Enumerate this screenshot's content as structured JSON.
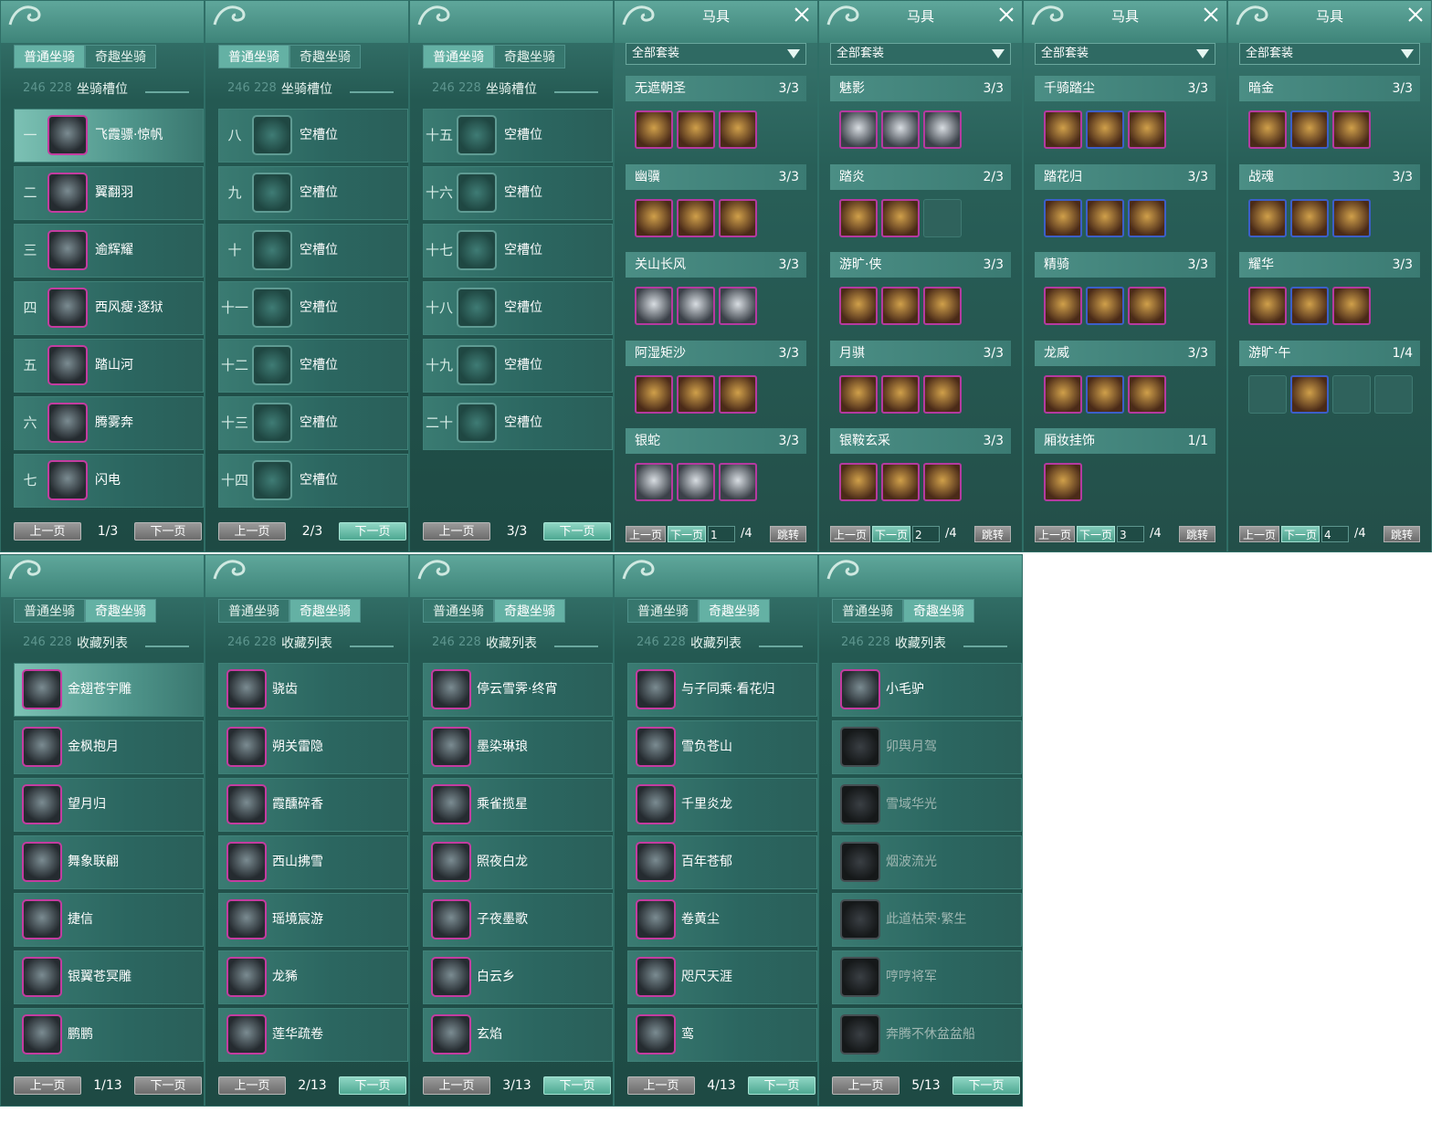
{
  "tabs": {
    "normal": "普通坐骑",
    "fun": "奇趣坐骑"
  },
  "ghost_numbers": "246  228",
  "slot_title": "坐骑槽位",
  "collection_title": "收藏列表",
  "prev_label": "上一页",
  "next_label": "下一页",
  "mount_pages": [
    {
      "page": "1/3",
      "rows": [
        {
          "num": "一",
          "name": "飞霞骠·惊帆",
          "state": "mount"
        },
        {
          "num": "二",
          "name": "翼翻羽",
          "state": "mount"
        },
        {
          "num": "三",
          "name": "逾辉耀",
          "state": "mount"
        },
        {
          "num": "四",
          "name": "西风瘦·逐狱",
          "state": "mount"
        },
        {
          "num": "五",
          "name": "踏山河",
          "state": "mount"
        },
        {
          "num": "六",
          "name": "腾雾奔",
          "state": "mount"
        },
        {
          "num": "七",
          "name": "闪电",
          "state": "mount"
        }
      ]
    },
    {
      "page": "2/3",
      "rows": [
        {
          "num": "八",
          "name": "空槽位",
          "state": "empty"
        },
        {
          "num": "九",
          "name": "空槽位",
          "state": "empty"
        },
        {
          "num": "十",
          "name": "空槽位",
          "state": "empty"
        },
        {
          "num": "十一",
          "name": "空槽位",
          "state": "empty"
        },
        {
          "num": "十二",
          "name": "空槽位",
          "state": "empty"
        },
        {
          "num": "十三",
          "name": "空槽位",
          "state": "empty"
        },
        {
          "num": "十四",
          "name": "空槽位",
          "state": "empty"
        }
      ]
    },
    {
      "page": "3/3",
      "rows": [
        {
          "num": "十五",
          "name": "空槽位",
          "state": "empty"
        },
        {
          "num": "十六",
          "name": "空槽位",
          "state": "empty"
        },
        {
          "num": "十七",
          "name": "空槽位",
          "state": "empty"
        },
        {
          "num": "十八",
          "name": "空槽位",
          "state": "empty"
        },
        {
          "num": "十九",
          "name": "空槽位",
          "state": "empty"
        },
        {
          "num": "二十",
          "name": "空槽位",
          "state": "empty"
        }
      ]
    }
  ],
  "harness": {
    "title": "马具",
    "filter": "全部套装",
    "jump_label": "跳转",
    "total": "/4",
    "pages": [
      {
        "page_input": "1",
        "sets": [
          {
            "name": "无遮朝圣",
            "count": "3/3",
            "items": 3,
            "owned": 3
          },
          {
            "name": "幽骥",
            "count": "3/3",
            "items": 3,
            "owned": 3
          },
          {
            "name": "关山长风",
            "count": "3/3",
            "items": 3,
            "owned": 3
          },
          {
            "name": "阿湿矩沙",
            "count": "3/3",
            "items": 3,
            "owned": 3
          },
          {
            "name": "银蛇",
            "count": "3/3",
            "items": 3,
            "owned": 3
          }
        ]
      },
      {
        "page_input": "2",
        "sets": [
          {
            "name": "魅影",
            "count": "3/3",
            "items": 3,
            "owned": 3
          },
          {
            "name": "踏炎",
            "count": "2/3",
            "items": 3,
            "owned": 2
          },
          {
            "name": "游旷·侠",
            "count": "3/3",
            "items": 3,
            "owned": 3
          },
          {
            "name": "月骐",
            "count": "3/3",
            "items": 3,
            "owned": 3
          },
          {
            "name": "银鞍玄采",
            "count": "3/3",
            "items": 3,
            "owned": 3
          }
        ]
      },
      {
        "page_input": "3",
        "sets": [
          {
            "name": "千骑踏尘",
            "count": "3/3",
            "items": 3,
            "owned": 3
          },
          {
            "name": "踏花归",
            "count": "3/3",
            "items": 3,
            "owned": 3
          },
          {
            "name": "精骑",
            "count": "3/3",
            "items": 3,
            "owned": 3
          },
          {
            "name": "龙威",
            "count": "3/3",
            "items": 3,
            "owned": 3
          },
          {
            "name": "厢妆挂饰",
            "count": "1/1",
            "items": 1,
            "owned": 1
          }
        ]
      },
      {
        "page_input": "4",
        "sets": [
          {
            "name": "暗金",
            "count": "3/3",
            "items": 3,
            "owned": 3
          },
          {
            "name": "战魂",
            "count": "3/3",
            "items": 3,
            "owned": 3
          },
          {
            "name": "耀华",
            "count": "3/3",
            "items": 3,
            "owned": 3
          },
          {
            "name": "游旷·午",
            "count": "1/4",
            "items": 4,
            "owned": 1
          }
        ]
      }
    ]
  },
  "collection_pages": [
    {
      "page": "1/13",
      "rows": [
        {
          "name": "金翅苍宇雕",
          "dim": false
        },
        {
          "name": "金枫抱月",
          "dim": false
        },
        {
          "name": "望月归",
          "dim": false
        },
        {
          "name": "舞象联翩",
          "dim": false
        },
        {
          "name": "捷信",
          "dim": false
        },
        {
          "name": "银翼苍冥雕",
          "dim": false
        },
        {
          "name": "鹏鹏",
          "dim": false
        }
      ]
    },
    {
      "page": "2/13",
      "rows": [
        {
          "name": "骁齿",
          "dim": false
        },
        {
          "name": "朔关雷隐",
          "dim": false
        },
        {
          "name": "霞醺碎香",
          "dim": false
        },
        {
          "name": "西山拂雪",
          "dim": false
        },
        {
          "name": "瑶境宸游",
          "dim": false
        },
        {
          "name": "龙豨",
          "dim": false
        },
        {
          "name": "莲华疏卷",
          "dim": false
        }
      ]
    },
    {
      "page": "3/13",
      "rows": [
        {
          "name": "停云雪霁·终宵",
          "dim": false
        },
        {
          "name": "墨染琳琅",
          "dim": false
        },
        {
          "name": "乘雀揽星",
          "dim": false
        },
        {
          "name": "照夜白龙",
          "dim": false
        },
        {
          "name": "子夜墨歌",
          "dim": false
        },
        {
          "name": "白云乡",
          "dim": false
        },
        {
          "name": "玄焰",
          "dim": false
        }
      ]
    },
    {
      "page": "4/13",
      "rows": [
        {
          "name": "与子同乘·看花归",
          "dim": false
        },
        {
          "name": "雪负苍山",
          "dim": false
        },
        {
          "name": "千里炎龙",
          "dim": false
        },
        {
          "name": "百年苍郁",
          "dim": false
        },
        {
          "name": "卷黄尘",
          "dim": false
        },
        {
          "name": "咫尺天涯",
          "dim": false
        },
        {
          "name": "鸾",
          "dim": false
        }
      ]
    },
    {
      "page": "5/13",
      "rows": [
        {
          "name": "小毛驴",
          "dim": false
        },
        {
          "name": "卯舆月驾",
          "dim": true
        },
        {
          "name": "雪域华光",
          "dim": true
        },
        {
          "name": "烟波流光",
          "dim": true
        },
        {
          "name": "此道枯荣·繁生",
          "dim": true
        },
        {
          "name": "哼哼将军",
          "dim": true
        },
        {
          "name": "奔腾不休盆盆船",
          "dim": true
        }
      ]
    }
  ]
}
